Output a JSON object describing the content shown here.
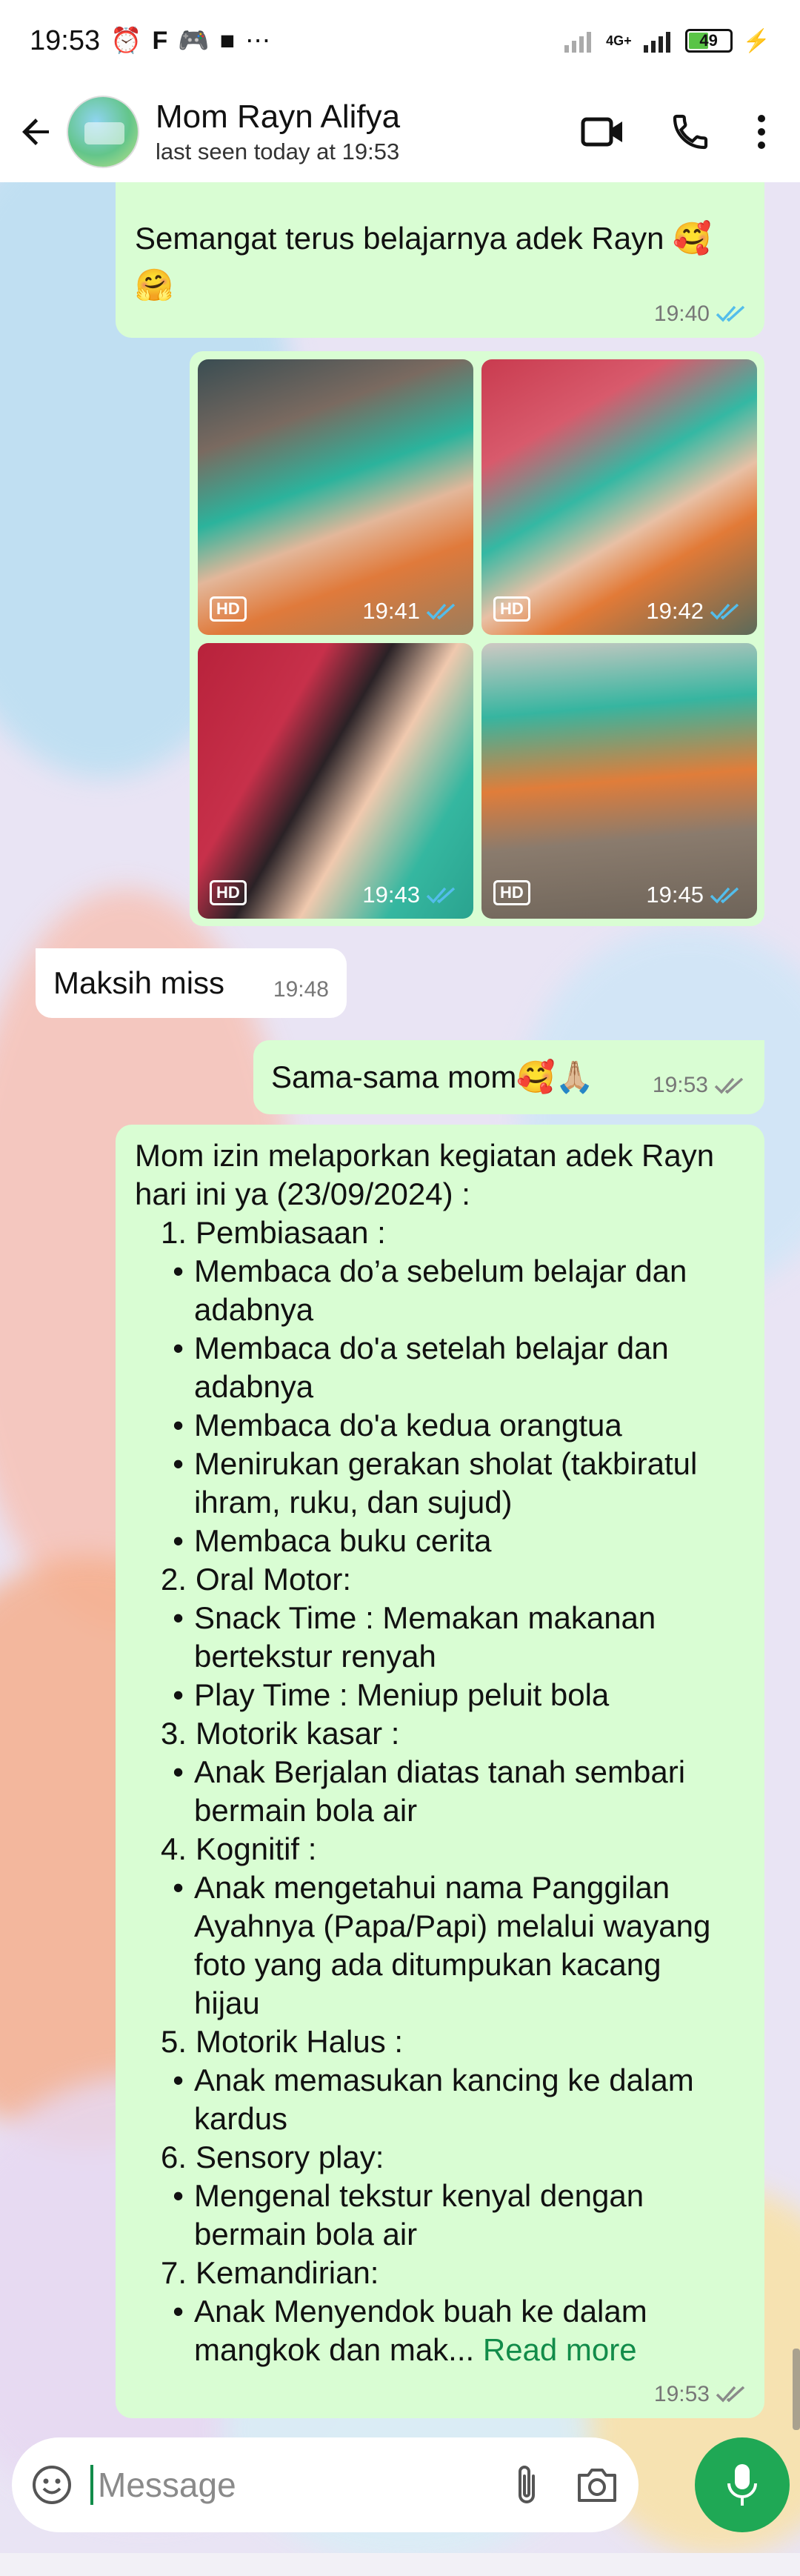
{
  "status_bar": {
    "time": "19:53",
    "network": "4G+",
    "battery": "49"
  },
  "header": {
    "contact_name": "Mom Rayn Alifya",
    "last_seen": "last seen today at 19:53"
  },
  "messages": {
    "m1": {
      "text_line1": "Semangat terus belajarnya adek Rayn 🥰",
      "text_line2": "🤗",
      "time": "19:40",
      "status": "read"
    },
    "photos": [
      {
        "time": "19:41",
        "badge": "HD"
      },
      {
        "time": "19:42",
        "badge": "HD"
      },
      {
        "time": "19:43",
        "badge": "HD"
      },
      {
        "time": "19:45",
        "badge": "HD"
      }
    ],
    "m2": {
      "text": "Maksih miss",
      "time": "19:48"
    },
    "m3": {
      "text": "Sama-sama mom🥰🙏🏼",
      "time": "19:53",
      "status": "delivered"
    },
    "report": {
      "intro_line1": "Mom izin melaporkan kegiatan adek Rayn",
      "intro_line2": "hari ini ya (23/09/2024) :",
      "items": [
        {
          "mark": "1.",
          "lines": [
            "Pembiasaan :"
          ]
        },
        {
          "mark": "•",
          "lines": [
            "Membaca do’a sebelum belajar dan",
            "adabnya"
          ]
        },
        {
          "mark": "•",
          "lines": [
            "Membaca do'a setelah belajar dan",
            "adabnya"
          ]
        },
        {
          "mark": "•",
          "lines": [
            "Membaca do'a kedua orangtua"
          ]
        },
        {
          "mark": "•",
          "lines": [
            "Menirukan gerakan sholat (takbiratul",
            "ihram, ruku, dan sujud)"
          ]
        },
        {
          "mark": "•",
          "lines": [
            "Membaca buku cerita"
          ]
        },
        {
          "mark": "2.",
          "lines": [
            "Oral Motor:"
          ]
        },
        {
          "mark": "•",
          "lines": [
            "Snack Time : Memakan makanan",
            "bertekstur renyah"
          ]
        },
        {
          "mark": "•",
          "lines": [
            "Play Time : Meniup peluit bola"
          ]
        },
        {
          "mark": "3.",
          "lines": [
            "Motorik kasar :"
          ]
        },
        {
          "mark": "•",
          "lines": [
            "Anak Berjalan diatas tanah sembari",
            "bermain  bola air"
          ]
        },
        {
          "mark": "4.",
          "lines": [
            "Kognitif :"
          ]
        },
        {
          "mark": "•",
          "lines": [
            "Anak mengetahui nama Panggilan",
            "Ayahnya (Papa/Papi) melalui wayang",
            "foto yang ada ditumpukan kacang",
            "hijau"
          ]
        },
        {
          "mark": "5.",
          "lines": [
            "Motorik Halus :"
          ]
        },
        {
          "mark": "•",
          "lines": [
            "Anak memasukan kancing ke dalam",
            "kardus"
          ]
        },
        {
          "mark": "6.",
          "lines": [
            "Sensory play:"
          ]
        },
        {
          "mark": "•",
          "lines": [
            "Mengenal tekstur kenyal dengan",
            "bermain bola air"
          ]
        },
        {
          "mark": "7.",
          "lines": [
            "Kemandirian:"
          ]
        },
        {
          "mark": "•",
          "lines": [
            "Anak Menyendok buah ke dalam",
            "mangkok dan mak..."
          ]
        }
      ],
      "read_more": "Read more",
      "time": "19:53",
      "status": "delivered"
    }
  },
  "input": {
    "placeholder": "Message"
  },
  "colors": {
    "outgoing_bubble": "#d9fdd3",
    "incoming_bubble": "#ffffff",
    "read_tick": "#53bdeb",
    "accent_green": "#1fa855"
  }
}
